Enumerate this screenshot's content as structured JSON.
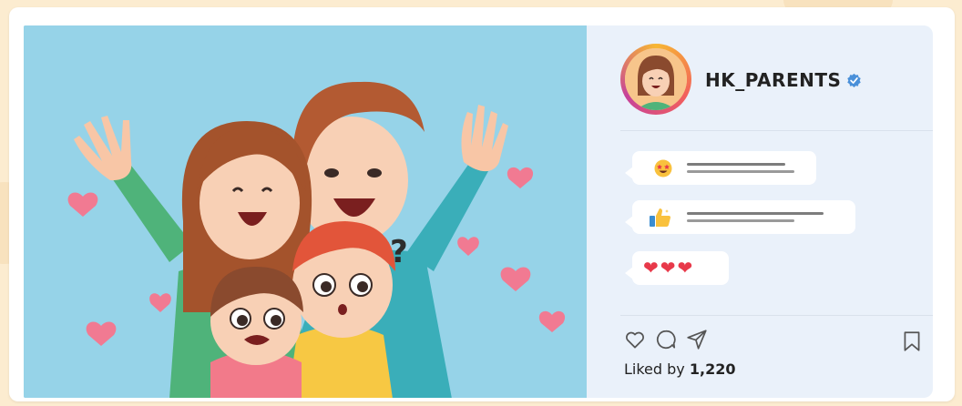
{
  "post": {
    "username": "HK_PARENTS",
    "verified": true,
    "likes_prefix": "Liked by ",
    "likes_count": "1,220",
    "comments": [
      {
        "reaction": "star-eyes-emoji-icon"
      },
      {
        "reaction": "thumbs-up-icon"
      },
      {
        "reaction": "three-hearts",
        "text": "❤❤❤"
      }
    ],
    "actions": [
      "heart-icon",
      "comment-icon",
      "share-icon",
      "bookmark-icon"
    ]
  },
  "colors": {
    "page_background": "#fcecd0",
    "image_background": "#96d3e8",
    "panel_background": "#eaf1fa",
    "verified_badge": "#4a90d9",
    "heart": "#e8394a"
  }
}
